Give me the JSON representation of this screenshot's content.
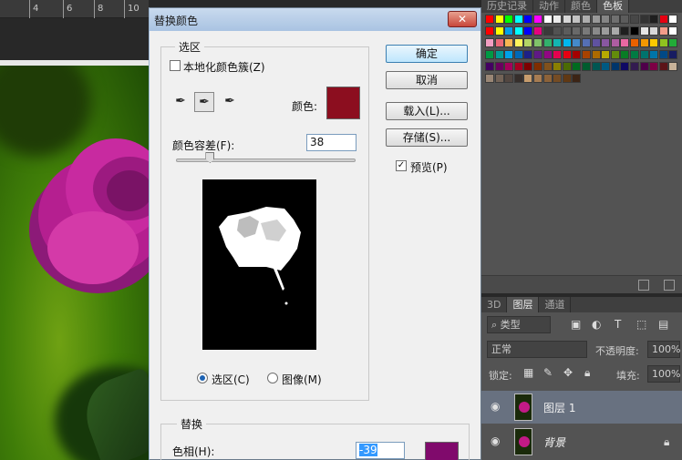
{
  "ruler": {
    "marks": [
      "4",
      "6",
      "8",
      "10"
    ]
  },
  "dialog": {
    "title": "替换颜色",
    "close_glyph": "✕",
    "selection_group": "选区",
    "localized_clusters": "本地化颜色簇(Z)",
    "color_label": "颜色:",
    "fuzziness_label": "颜色容差(F):",
    "fuzziness_value": "38",
    "fuzziness_level": 0.19,
    "radio_selection": "选区(C)",
    "radio_image": "图像(M)",
    "replace_group": "替换",
    "hue_label": "色相(H):",
    "hue_value": "-39",
    "buttons": {
      "ok": "确定",
      "cancel": "取消",
      "load": "载入(L)...",
      "save": "存储(S)..."
    },
    "preview_label": "预览(P)",
    "preview_checked": true,
    "sample_color": "#8c0e1f",
    "result_color": "#800a6c"
  },
  "panels": {
    "top_tabs": [
      "历史记录",
      "动作",
      "颜色",
      "色板"
    ],
    "active_top_tab": "色板",
    "layer_tabs": [
      "3D",
      "图层",
      "通道"
    ],
    "active_layer_tab": "图层",
    "filter_kind": "类型",
    "blend_mode": "正常",
    "opacity_label": "不透明度:",
    "opacity_value": "100%",
    "lock_label": "锁定:",
    "fill_label": "填充:",
    "fill_value": "100%",
    "layers": [
      {
        "name": "图层 1",
        "selected": true,
        "locked": false
      },
      {
        "name": "背景",
        "selected": false,
        "locked": true
      }
    ]
  },
  "icons": {
    "eye": "eye-icon",
    "lock": "lock-icon",
    "dropper": "eyedropper-icon",
    "dropper_add": "eyedropper-plus-icon",
    "dropper_sub": "eyedropper-minus-icon"
  }
}
